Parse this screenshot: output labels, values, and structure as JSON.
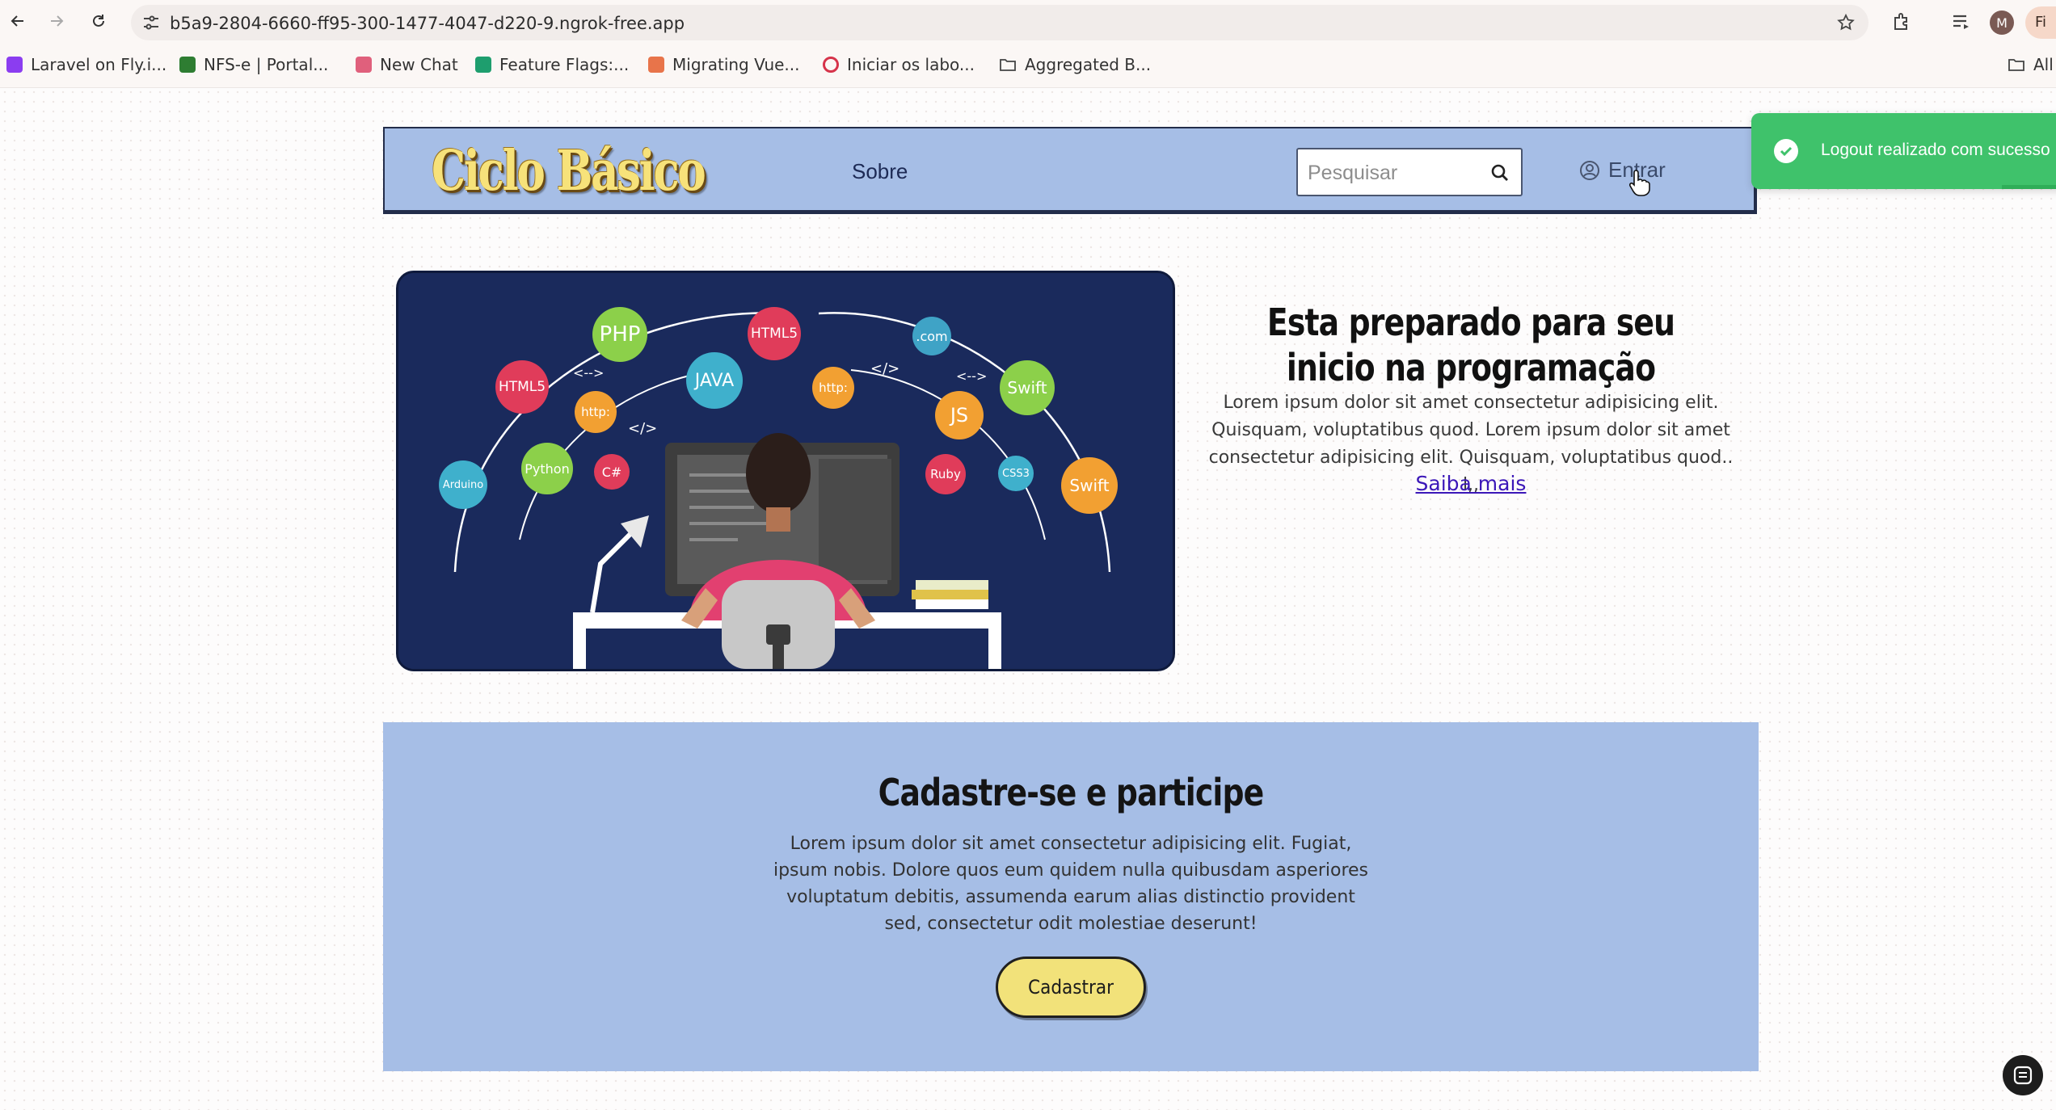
{
  "browser": {
    "url": "b5a9-2804-6660-ff95-300-1477-4047-d220-9.ngrok-free.app",
    "profile_initial": "M",
    "profile_chip": "Fi",
    "bookmarks": [
      {
        "label": "Laravel on Fly.i...",
        "color": "#8b3df0"
      },
      {
        "label": "NFS-e | Portal...",
        "color": "#2e7d32"
      },
      {
        "label": "New Chat",
        "color": "#e0607c"
      },
      {
        "label": "Feature Flags:...",
        "color": "#1e9e6e"
      },
      {
        "label": "Migrating Vue...",
        "color": "#e8744a"
      },
      {
        "label": "Iniciar os labo...",
        "color": "#d6334a"
      },
      {
        "label": "Aggregated B...",
        "color": "#555555"
      }
    ],
    "all_bookmarks": "All"
  },
  "header": {
    "logo": "Ciclo Básico",
    "nav_sobre": "Sobre",
    "search_placeholder": "Pesquisar",
    "login": "Entrar"
  },
  "toast": {
    "message": "Logout realizado com sucesso"
  },
  "hero": {
    "title": "Esta preparado para seu inicio na programação",
    "text": "Lorem ipsum dolor sit amet consectetur adipisicing elit. Quisquam, voluptatibus quod. Lorem ipsum dolor sit amet consectetur adipisicing elit. Quisquam, voluptatibus quod.. l,,",
    "link": "Saiba mais",
    "tech_bubbles": [
      "PHP",
      "HTML5",
      "HTML5",
      ".com",
      "JAVA",
      "http:",
      "http:",
      "Swift",
      "JS",
      "Swift",
      "Python",
      "C#",
      "Ruby",
      "CSS3",
      "Arduino",
      "</>",
      "</>",
      "<-->",
      "<-->"
    ]
  },
  "signup": {
    "title": "Cadastre-se e participe",
    "text": "Lorem ipsum dolor sit amet consectetur adipisicing elit. Fugiat, ipsum nobis. Dolore quos eum quidem nulla quibusdam asperiores voluptatum debitis, assumenda earum alias distinctio provident sed, consectetur odit molestiae deserunt!",
    "button": "Cadastrar"
  },
  "colors": {
    "header_bg": "#a6bee6",
    "toast_bg": "#3fc26b",
    "button_bg": "#f2e27a",
    "link": "#3b17b8",
    "hero_bg": "#1a2a5c"
  }
}
